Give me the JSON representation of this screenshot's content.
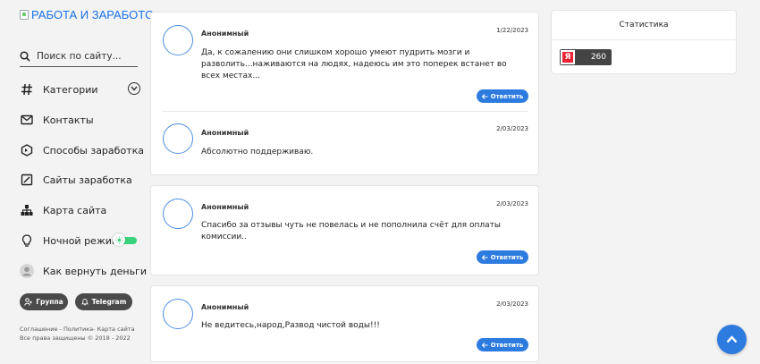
{
  "sidebar": {
    "logo_alt": "РАБОТА И ЗАРАБОТС",
    "search_placeholder": "Поиск по сайту...",
    "items": [
      {
        "label": "Категории"
      },
      {
        "label": "Контакты"
      },
      {
        "label": "Способы заработка"
      },
      {
        "label": "Сайты заработка"
      },
      {
        "label": "Карта сайта"
      },
      {
        "label": "Ночной режим"
      },
      {
        "label": "Как вернуть деньги"
      }
    ],
    "social": {
      "group": "Группа",
      "telegram": "Telegram"
    },
    "footer_links": "Соглашение - Политика- Карта сайта",
    "copyright": "Все права защищены © 2018 - 2022"
  },
  "comments": [
    {
      "author": "Анонимный",
      "date": "1/22/2023",
      "text": "Да, к сожалению они слишком хорошо умеют пудрить мозги и разволить...наживаются на людях, надеюсь им это поперек встанет во всех местах...",
      "reply": "Ответить"
    },
    {
      "author": "Анонимный",
      "date": "2/03/2023",
      "text": "Абсолютно поддерживаю.",
      "reply": ""
    },
    {
      "author": "Анонимный",
      "date": "2/03/2023",
      "text": "Спасибо за отзывы чуть не повелась и не пополнила счёт для оплаты комиссии..",
      "reply": "Ответить"
    },
    {
      "author": "Анонимный",
      "date": "2/03/2023",
      "text": "Не ведитесь,народ,Развод чистой воды!!!",
      "reply": "Ответить"
    }
  ],
  "stats": {
    "title": "Статистика",
    "counter_logo": "Я",
    "counter_value": "260"
  },
  "colors": {
    "accent": "#2e7be0",
    "avatar_ring": "#4a8fe0",
    "toggle": "#38d37a",
    "yandex": "#e22233"
  }
}
